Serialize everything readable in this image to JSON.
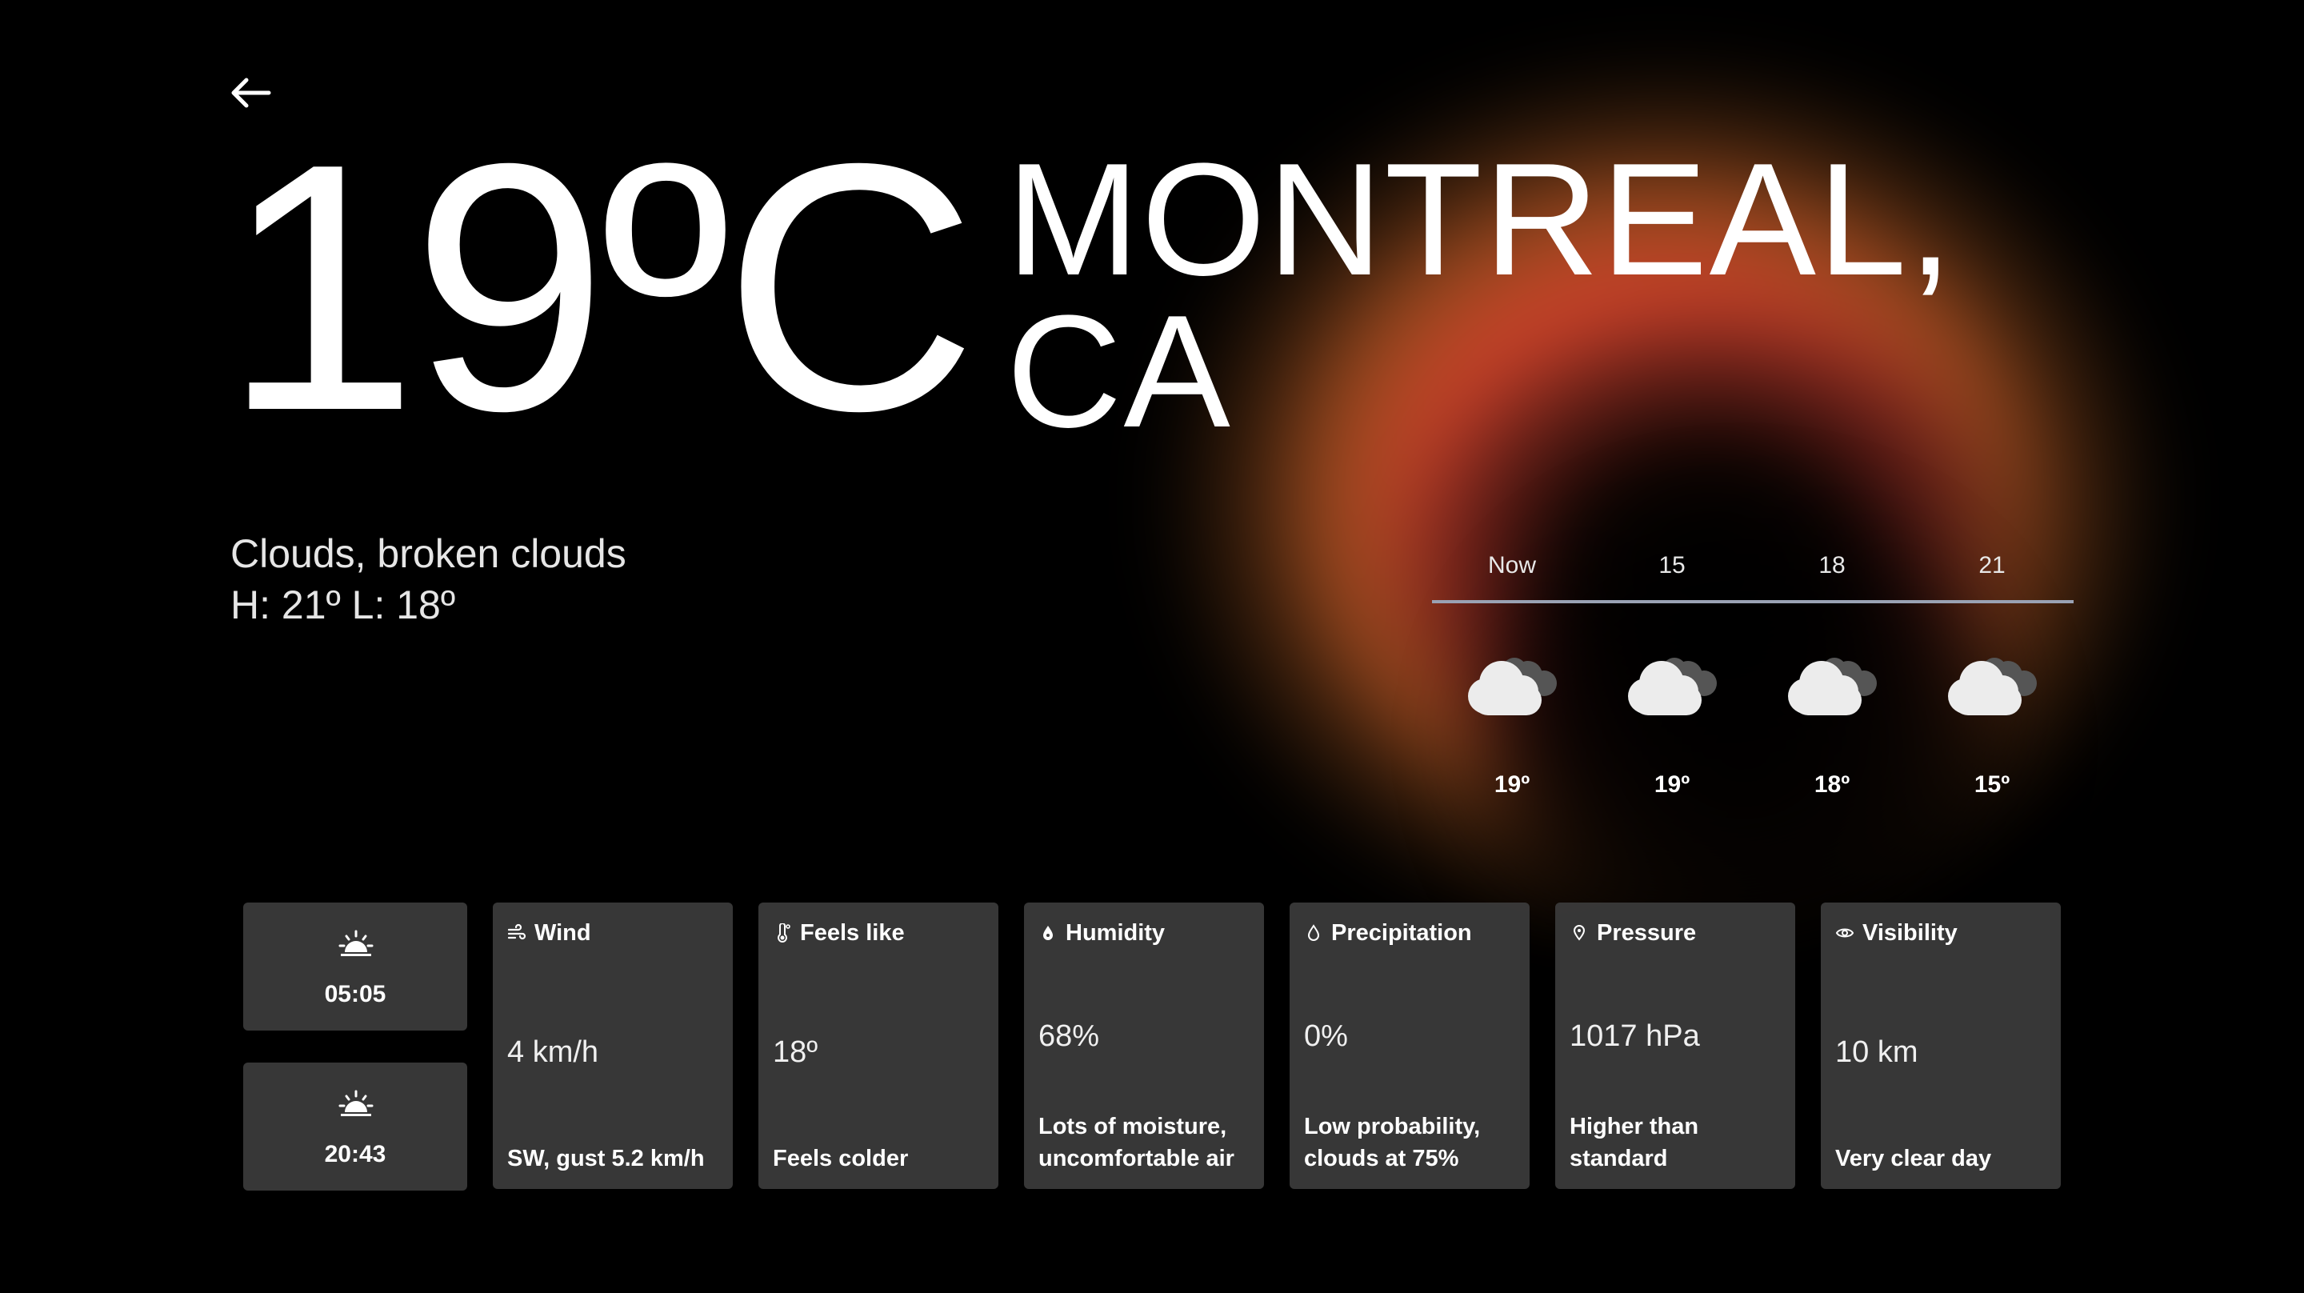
{
  "header": {
    "back_icon": "arrow-left-icon",
    "temperature": "19ºC",
    "city": "MONTREAL, CA"
  },
  "summary": {
    "condition": "Clouds, broken clouds",
    "high_low": "H: 21º L: 18º"
  },
  "forecast": {
    "hours": [
      {
        "label": "Now",
        "icon": "cloudy-icon",
        "temp": "19º"
      },
      {
        "label": "15",
        "icon": "cloudy-icon",
        "temp": "19º"
      },
      {
        "label": "18",
        "icon": "cloudy-icon",
        "temp": "18º"
      },
      {
        "label": "21",
        "icon": "cloudy-icon",
        "temp": "15º"
      }
    ]
  },
  "sun": {
    "sunrise": {
      "icon": "sunrise-icon",
      "time": "05:05"
    },
    "sunset": {
      "icon": "sunset-icon",
      "time": "20:43"
    }
  },
  "metrics": {
    "wind": {
      "icon": "wind-icon",
      "title": "Wind",
      "value": "4 km/h",
      "note": "SW, gust 5.2 km/h"
    },
    "feels_like": {
      "icon": "thermometer-icon",
      "title": "Feels like",
      "value": "18º",
      "note": "Feels colder"
    },
    "humidity": {
      "icon": "humidity-drop-icon",
      "title": "Humidity",
      "value": "68%",
      "note": "Lots of moisture, uncomfortable air"
    },
    "precipitation": {
      "icon": "drop-icon",
      "title": "Precipitation",
      "value": "0%",
      "note": "Low probability, clouds at 75%"
    },
    "pressure": {
      "icon": "pressure-pin-icon",
      "title": "Pressure",
      "value": "1017 hPa",
      "note": "Higher than standard"
    },
    "visibility": {
      "icon": "eye-icon",
      "title": "Visibility",
      "value": "10 km",
      "note": "Very clear day"
    }
  },
  "colors": {
    "background": "#000000",
    "card": "#3c3c3c",
    "glow_orange": "#e6502a",
    "divider": "#9aa2b4"
  }
}
